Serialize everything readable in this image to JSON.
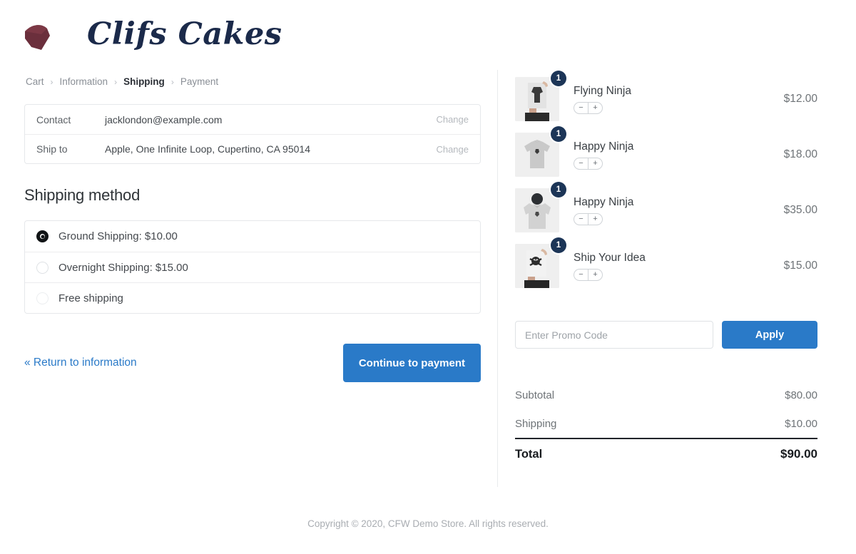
{
  "brand": {
    "name": "Clifs Cakes",
    "mark_icon": "cake-slice-icon",
    "mark_color": "#6b2f3c",
    "name_color": "#1b2a4a"
  },
  "breadcrumb": {
    "separator": "›",
    "items": [
      {
        "label": "Cart",
        "active": false
      },
      {
        "label": "Information",
        "active": false
      },
      {
        "label": "Shipping",
        "active": true
      },
      {
        "label": "Payment",
        "active": false
      }
    ]
  },
  "summary": {
    "rows": [
      {
        "label": "Contact",
        "value": "jacklondon@example.com",
        "action": "Change"
      },
      {
        "label": "Ship to",
        "value": "Apple, One Infinite Loop, Cupertino, CA 95014",
        "action": "Change"
      }
    ]
  },
  "shipping": {
    "title": "Shipping method",
    "options": [
      {
        "label": "Ground Shipping: $10.00",
        "selected": true
      },
      {
        "label": "Overnight Shipping: $15.00",
        "selected": false
      },
      {
        "label": "Free shipping",
        "selected": false
      }
    ]
  },
  "actions": {
    "return_label": "« Return to information",
    "continue_label": "Continue to payment",
    "button_color": "#2a7ac8"
  },
  "cart": {
    "badge_color": "#1c3557",
    "stepper": {
      "minus": "−",
      "plus": "+"
    },
    "items": [
      {
        "name": "Flying Ninja",
        "price": "$12.00",
        "qty": "1",
        "thumb_icon": "person-holding-tshirt-icon"
      },
      {
        "name": "Happy Ninja",
        "price": "$18.00",
        "qty": "1",
        "thumb_icon": "gray-tshirt-icon"
      },
      {
        "name": "Happy Ninja",
        "price": "$35.00",
        "qty": "1",
        "thumb_icon": "gray-hoodie-icon"
      },
      {
        "name": "Ship Your Idea",
        "price": "$15.00",
        "qty": "1",
        "thumb_icon": "person-holding-skull-tshirt-icon"
      }
    ]
  },
  "promo": {
    "placeholder": "Enter Promo Code",
    "value": "",
    "apply_label": "Apply"
  },
  "totals": {
    "rows": [
      {
        "label": "Subtotal",
        "amount": "$80.00"
      },
      {
        "label": "Shipping",
        "amount": "$10.00"
      }
    ],
    "grand": {
      "label": "Total",
      "amount": "$90.00"
    }
  },
  "footer": {
    "text": "Copyright © 2020, CFW Demo Store. All rights reserved."
  }
}
